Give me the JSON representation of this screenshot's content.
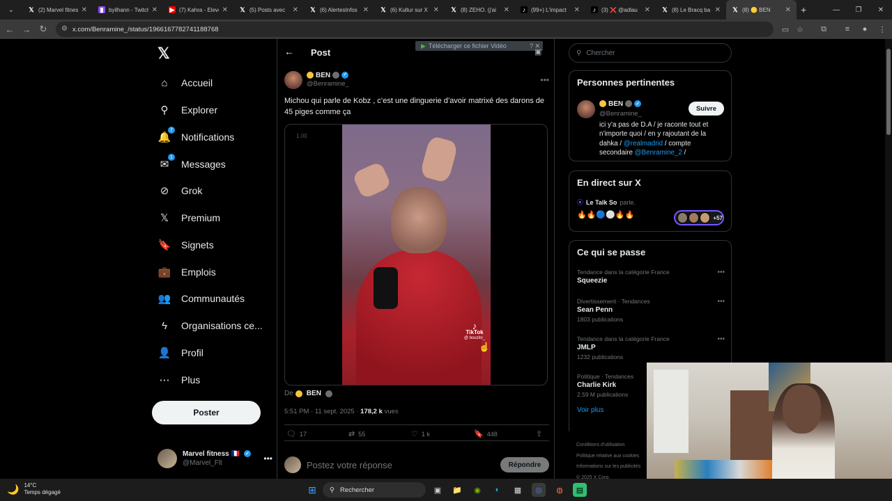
{
  "browser": {
    "tabs": [
      {
        "title": "(2) Marvel fitness",
        "icon": "x-icon",
        "active": false
      },
      {
        "title": "byilhann - Twitch",
        "icon": "twitch-icon",
        "active": false
      },
      {
        "title": "(7) Kahra - Eleve",
        "icon": "youtube-icon",
        "active": false
      },
      {
        "title": "(5) Posts avec",
        "icon": "x-icon",
        "active": false
      },
      {
        "title": "(6) AlertesInfos",
        "icon": "x-icon",
        "active": false
      },
      {
        "title": "(6) Kultur sur X",
        "icon": "x-icon",
        "active": false
      },
      {
        "title": "(8) ZEHO. (j'ai",
        "icon": "x-icon",
        "active": false
      },
      {
        "title": "(99+) L'impact",
        "icon": "tiktok-icon",
        "active": false
      },
      {
        "title": "(3) ❌ @adlau",
        "icon": "tiktok-icon",
        "active": false
      },
      {
        "title": "(8) Le Bracq ba",
        "icon": "x-icon",
        "active": false
      },
      {
        "title": "(8) 🟡 BEN",
        "icon": "x-icon",
        "active": true
      }
    ],
    "url": "x.com/Benramine_/status/1966167782741188768"
  },
  "sidebar": {
    "items": [
      {
        "label": "Accueil",
        "icon": "home-icon",
        "glyph": "⌂"
      },
      {
        "label": "Explorer",
        "icon": "search-icon",
        "glyph": "⚲"
      },
      {
        "label": "Notifications",
        "icon": "bell-icon",
        "glyph": "🔔",
        "badge": "7"
      },
      {
        "label": "Messages",
        "icon": "envelope-icon",
        "glyph": "✉",
        "badge": "1"
      },
      {
        "label": "Grok",
        "icon": "grok-icon",
        "glyph": "⊘"
      },
      {
        "label": "Premium",
        "icon": "x-logo-icon",
        "glyph": "𝕏"
      },
      {
        "label": "Signets",
        "icon": "bookmark-icon",
        "glyph": "🔖"
      },
      {
        "label": "Emplois",
        "icon": "briefcase-icon",
        "glyph": "💼"
      },
      {
        "label": "Communautés",
        "icon": "people-icon",
        "glyph": "👥"
      },
      {
        "label": "Organisations ce...",
        "icon": "lightning-icon",
        "glyph": "ϟ"
      },
      {
        "label": "Profil",
        "icon": "person-icon",
        "glyph": "👤"
      },
      {
        "label": "Plus",
        "icon": "more-circle-icon",
        "glyph": "⋯"
      }
    ],
    "post_button": "Poster",
    "account": {
      "name": "Marvel fitness 🇫🇷",
      "handle": "@Marvel_Flt"
    }
  },
  "post": {
    "header_title": "Post",
    "download_bar": "Télécharger ce fichier Vidéo",
    "author_name": "BEN",
    "author_handle": "@Benramine_",
    "text": "Michou qui parle de Kobz , c’est une dinguerie d’avoir matrixé des darons de 45 piges comme ça",
    "video_speed": "1.00",
    "video_watermark": "TikTok",
    "video_watermark_handle": "@ bouzitv_",
    "from_label": "De",
    "from_name": "BEN",
    "time": "5:51 PM",
    "date": "11 sept. 2025",
    "views": "178,2 k",
    "views_label": "vues",
    "replies": "17",
    "reposts": "55",
    "likes": "1 k",
    "bookmarks": "448",
    "reply_placeholder": "Postez votre réponse",
    "reply_button": "Répondre"
  },
  "right": {
    "search_placeholder": "Chercher",
    "relevant": {
      "title": "Personnes pertinentes",
      "name": "BEN",
      "handle": "@Benramine_",
      "follow": "Suivre",
      "bio_text": "ici y’a pas de D.A / je raconte tout et n’importe quoi / en y rajoutant de la dahka / ",
      "bio_link1": "@realmadrid",
      "bio_mid": " / compte secondaire ",
      "bio_link2": "@Benramine_2",
      "bio_end": " /"
    },
    "live": {
      "title": "En direct sur X",
      "host": "Le Talk So",
      "action": "parle.",
      "emojis": "🔥🔥🔵⚪🔥🔥",
      "count": "+57"
    },
    "trends": {
      "title": "Ce qui se passe",
      "items": [
        {
          "category": "Tendance dans la catégorie France",
          "name": "Squeezie",
          "count": ""
        },
        {
          "category": "Divertissement · Tendances",
          "name": "Sean Penn",
          "count": "1803 publications"
        },
        {
          "category": "Tendance dans la catégorie France",
          "name": "JMLP",
          "count": "1232 publications"
        },
        {
          "category": "Politique · Tendances",
          "name": "Charlie Kirk",
          "count": "2,59 M publications"
        }
      ],
      "see_more": "Voir plus"
    },
    "footer": [
      "Conditions d'utilisation",
      "Politique relative aux cookies",
      "Informations sur les publicités",
      "© 2025 X Corp."
    ]
  },
  "taskbar": {
    "temp": "14°C",
    "weather": "Temps dégagé",
    "search": "Rechercher"
  }
}
